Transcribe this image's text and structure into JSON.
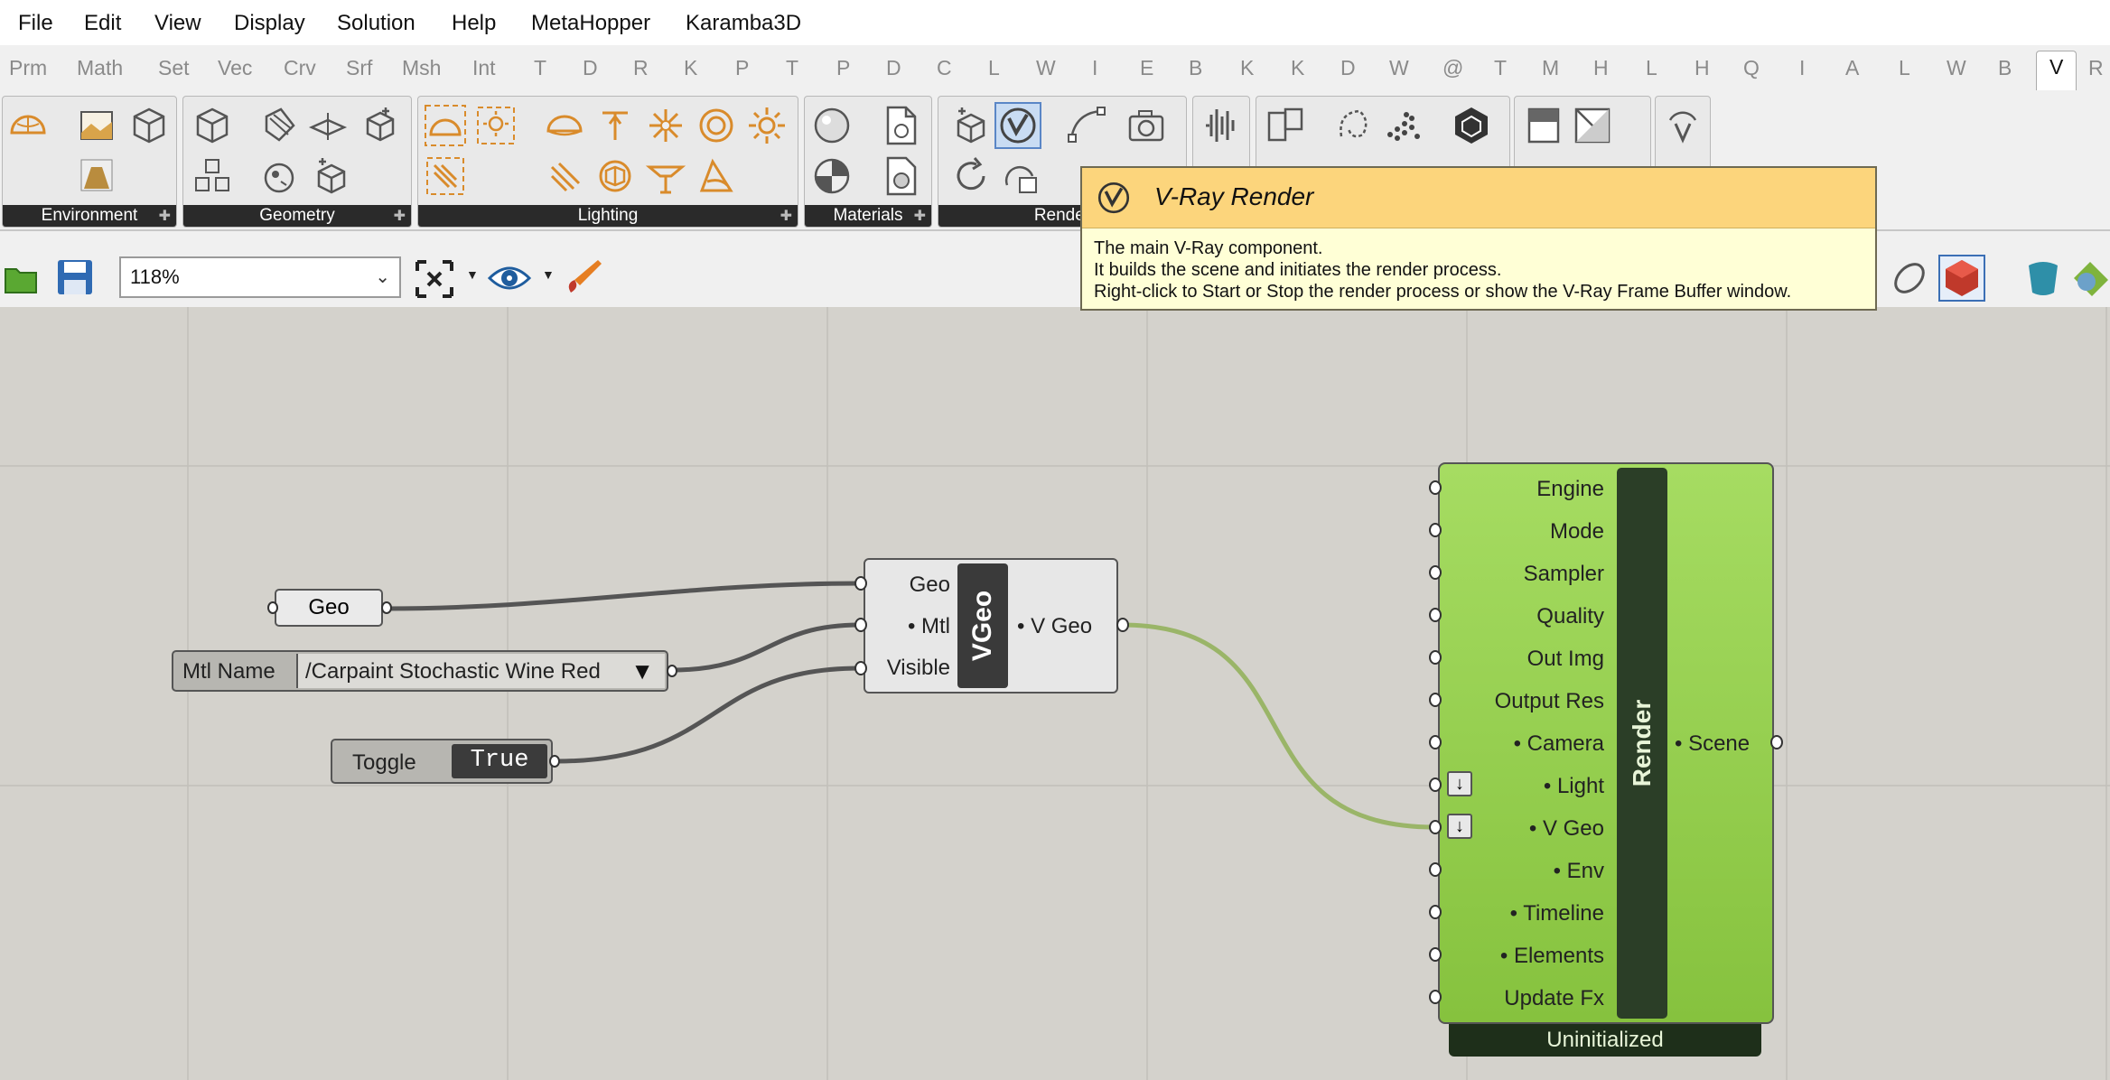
{
  "menu": [
    "File",
    "Edit",
    "View",
    "Display",
    "Solution",
    "Help",
    "MetaHopper",
    "Karamba3D"
  ],
  "tabs": [
    "Prm",
    "Math",
    "Set",
    "Vec",
    "Crv",
    "Srf",
    "Msh",
    "Int",
    "T",
    "D",
    "R",
    "K",
    "P",
    "T",
    "P",
    "D",
    "C",
    "L",
    "W",
    "I",
    "E",
    "B",
    "K",
    "K",
    "D",
    "W",
    "@",
    "T",
    "M",
    "H",
    "L",
    "H",
    "Q",
    "I",
    "A",
    "L",
    "W",
    "B",
    "V",
    "R"
  ],
  "ribbon_panels": [
    "Environment",
    "Geometry",
    "Lighting",
    "Materials",
    "Render"
  ],
  "toolbar": {
    "zoom": "118%"
  },
  "tooltip": {
    "title": "V-Ray Render",
    "line1": "The main V-Ray component.",
    "line2": "It builds the scene and initiates the render process.",
    "line3": "Right-click to Start or Stop the render process or show the V-Ray Frame Buffer window."
  },
  "nodes": {
    "geo_param": "Geo",
    "mtl": {
      "label": "Mtl Name",
      "value": "/Carpaint Stochastic Wine Red"
    },
    "toggle": {
      "label": "Toggle",
      "value": "True"
    },
    "vgeo": {
      "title": "VGeo",
      "inputs": [
        "Geo",
        "• Mtl",
        "Visible"
      ],
      "output": "• V Geo"
    },
    "render": {
      "title": "Render",
      "inputs": [
        "Engine",
        "Mode",
        "Sampler",
        "Quality",
        "Out Img",
        "Output Res",
        "• Camera",
        "• Light",
        "• V Geo",
        "• Env",
        "• Timeline",
        "• Elements",
        "Update Fx"
      ],
      "output": "• Scene",
      "status": "Uninitialized"
    }
  },
  "colors": {
    "accent_orange": "#d98b2b",
    "render_green": "#8fce48",
    "canvas": "#d4d2cc",
    "tooltip_header": "#fcd57c"
  }
}
